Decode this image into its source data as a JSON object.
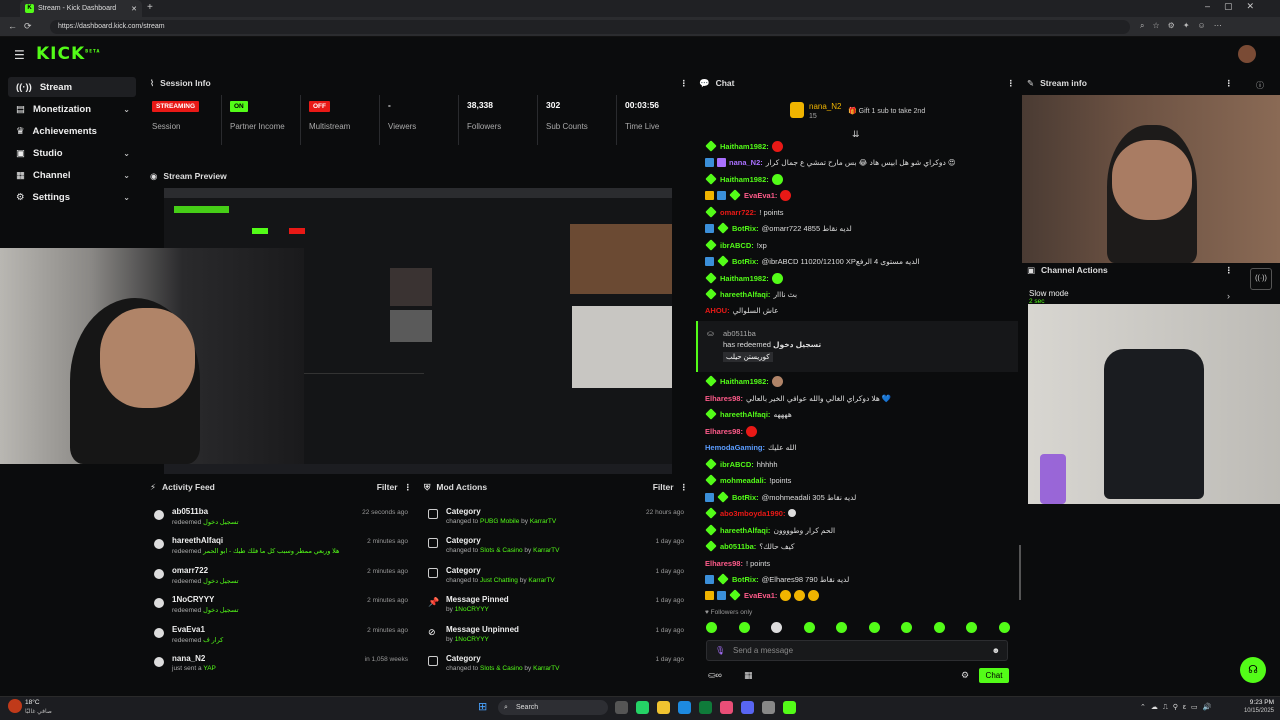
{
  "browser": {
    "tab_title": "Stream - Kick Dashboard",
    "url": "https://dashboard.kick.com/stream"
  },
  "logo": {
    "text": "KICK",
    "sup": "BETA"
  },
  "sidebar": {
    "items": [
      {
        "label": "Stream",
        "active": true,
        "chevron": false
      },
      {
        "label": "Monetization",
        "chevron": true
      },
      {
        "label": "Achievements",
        "chevron": false
      },
      {
        "label": "Studio",
        "chevron": true
      },
      {
        "label": "Channel",
        "chevron": true
      },
      {
        "label": "Settings",
        "chevron": true
      }
    ]
  },
  "session": {
    "title": "Session Info",
    "stats": [
      {
        "value": "STREAMING",
        "label": "Session",
        "kind": "red"
      },
      {
        "value": "ON",
        "label": "Partner Income",
        "kind": "green"
      },
      {
        "value": "OFF",
        "label": "Multistream",
        "kind": "red"
      },
      {
        "value": "-",
        "label": "Viewers"
      },
      {
        "value": "38,338",
        "label": "Followers"
      },
      {
        "value": "302",
        "label": "Sub Counts"
      },
      {
        "value": "00:03:56",
        "label": "Time Live"
      }
    ]
  },
  "preview": {
    "title": "Stream Preview"
  },
  "activity": {
    "title": "Activity Feed",
    "filter": "Filter",
    "rows": [
      {
        "user": "ab0511ba",
        "action": "redeemed",
        "item": "تسجيل دخول",
        "time": "22 seconds ago"
      },
      {
        "user": "hareethAlfaqi",
        "action": "redeemed",
        "item": "هلا وربعي ممطر وسبب كل ما فلك طبك - ابو الحمر",
        "time": "2 minutes ago"
      },
      {
        "user": "omarr722",
        "action": "redeemed",
        "item": "تسجيل دخول",
        "time": "2 minutes ago"
      },
      {
        "user": "1NoCRYYY",
        "action": "redeemed",
        "item": "تسجيل دخول",
        "time": "2 minutes ago"
      },
      {
        "user": "EvaEva1",
        "action": "redeemed",
        "item": "كرار ف",
        "time": "2 minutes ago"
      },
      {
        "user": "nana_N2",
        "action": "just sent a",
        "item": "YAP",
        "time": "in 1,058 weeks"
      }
    ]
  },
  "mod": {
    "title": "Mod Actions",
    "filter": "Filter",
    "rows": [
      {
        "title": "Category",
        "action": "changed to",
        "item": "PUBG Mobile",
        "by": "KarrarTV",
        "time": "22 hours ago"
      },
      {
        "title": "Category",
        "action": "changed to",
        "item": "Slots & Casino",
        "by": "KarrarTV",
        "time": "1 day ago"
      },
      {
        "title": "Category",
        "action": "changed to",
        "item": "Just Chatting",
        "by": "KarrarTV",
        "time": "1 day ago"
      },
      {
        "title": "Message Pinned",
        "action": "by",
        "item": "1NoCRYYY",
        "by": "",
        "time": "1 day ago"
      },
      {
        "title": "Message Unpinned",
        "action": "by",
        "item": "1NoCRYYY",
        "by": "",
        "time": "1 day ago"
      },
      {
        "title": "Category",
        "action": "changed to",
        "item": "Slots & Casino",
        "by": "KarrarTV",
        "time": "1 day ago"
      }
    ]
  },
  "chat": {
    "title": "Chat",
    "pinned_user": "nana_N2",
    "pinned_count": "15",
    "gift_text": "Gift 1 sub to take 2nd",
    "messages": [
      {
        "user": "Haitham1982:",
        "color": "#53fc18",
        "text": ""
      },
      {
        "user": "nana_N2:",
        "color": "#a970ff",
        "text": "دوكراي شو هل ابيس هاد 😂 بس مارح تمشي ع جمال كرار 😍"
      },
      {
        "user": "Haitham1982:",
        "color": "#53fc18",
        "text": ""
      },
      {
        "user": "EvaEva1:",
        "color": "#ff5b8a",
        "text": ""
      },
      {
        "user": "omarr722:",
        "color": "#e91916",
        "text": "! points"
      },
      {
        "user": "BotRix:",
        "color": "#53fc18",
        "text": "@omarr722 4855 لديه نقاط"
      },
      {
        "user": "ibrABCD:",
        "color": "#53fc18",
        "text": "!xp"
      },
      {
        "user": "BotRix:",
        "color": "#53fc18",
        "text": "@ibrABCD 11020/12100 XPالديه مستوى 4 الرفع"
      },
      {
        "user": "Haitham1982:",
        "color": "#53fc18",
        "text": ""
      },
      {
        "user": "hareethAlfaqi:",
        "color": "#53fc18",
        "text": "بث نااار"
      },
      {
        "user": "AHOU:",
        "color": "#e91916",
        "text": "عاش السلوالي"
      }
    ],
    "redeem": {
      "user": "ab0511ba",
      "text": "has redeemed",
      "item": "تسجيل دخول",
      "sub": "كوريستن حيلب"
    },
    "messages2": [
      {
        "user": "Haitham1982:",
        "color": "#53fc18",
        "text": ""
      },
      {
        "user": "Elhares98:",
        "color": "#ff5b8a",
        "text": "هلا دوكراي الغالي والله عوافي الخير بالعالي 💙"
      },
      {
        "user": "hareethAlfaqi:",
        "color": "#53fc18",
        "text": "ههههه"
      },
      {
        "user": "Elhares98:",
        "color": "#ff5b8a",
        "text": ""
      },
      {
        "user": "HemodaGaming:",
        "color": "#5b9dff",
        "text": "الله عليك"
      },
      {
        "user": "ibrABCD:",
        "color": "#53fc18",
        "text": "hhhhh"
      },
      {
        "user": "mohmeadali:",
        "color": "#53fc18",
        "text": "!points"
      },
      {
        "user": "BotRix:",
        "color": "#53fc18",
        "text": "@mohmeadali 305 لديه نقاط"
      },
      {
        "user": "abo3mboyda1990:",
        "color": "#e91916",
        "text": ""
      },
      {
        "user": "hareethAlfaqi:",
        "color": "#53fc18",
        "text": "الحم كرار وطوووون"
      },
      {
        "user": "ab0511ba:",
        "color": "#53fc18",
        "text": "كيف حالك؟"
      },
      {
        "user": "Elhares98:",
        "color": "#ff5b8a",
        "text": "! points"
      },
      {
        "user": "BotRix:",
        "color": "#53fc18",
        "text": "@Elhares98 790 لديه نقاط"
      },
      {
        "user": "EvaEva1:",
        "color": "#ff5b8a",
        "text": ""
      }
    ],
    "followers_only": "Followers only",
    "placeholder": "Send a message",
    "send": "Chat"
  },
  "stream_info": {
    "title": "Stream info"
  },
  "channel_actions": {
    "title": "Channel Actions",
    "slow_mode": "Slow mode",
    "slow_value": "2 sec"
  },
  "taskbar": {
    "search": "Search",
    "weather_temp": "18°C",
    "weather_label": "صافي غالبًا",
    "time": "9:23 PM",
    "date": "10/15/2025"
  }
}
